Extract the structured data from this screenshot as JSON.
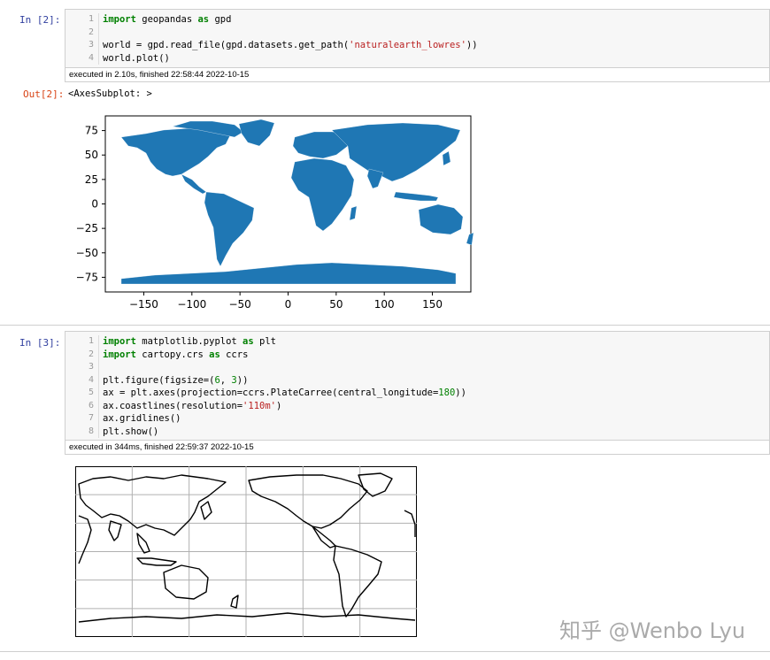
{
  "cell1": {
    "prompt": "In  [2]:",
    "line_numbers": [
      "1",
      "2",
      "3",
      "4"
    ],
    "exec_info": "executed in 2.10s, finished 22:58:44 2022-10-15",
    "out_prompt": "Out[2]:",
    "out_text": "<AxesSubplot: >"
  },
  "plot1": {
    "yticks": [
      "75",
      "50",
      "25",
      "0",
      "−25",
      "−50",
      "−75"
    ],
    "xticks": [
      "−150",
      "−100",
      "−50",
      "0",
      "50",
      "100",
      "150"
    ],
    "fill_color": "#1f77b4"
  },
  "cell2": {
    "prompt": "In  [3]:",
    "line_numbers": [
      "1",
      "2",
      "3",
      "4",
      "5",
      "6",
      "7",
      "8"
    ],
    "exec_info": "executed in 344ms, finished 22:59:37 2022-10-15"
  },
  "watermark": "知乎 @Wenbo Lyu"
}
